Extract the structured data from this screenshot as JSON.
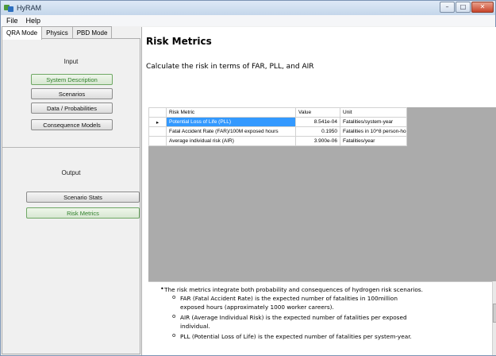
{
  "window": {
    "title": "HyRAM",
    "controls": {
      "minimize": "–",
      "maximize": "□",
      "close": "✕"
    }
  },
  "menu": [
    "File",
    "Help"
  ],
  "mode_tabs": [
    "QRA Mode",
    "Physics",
    "PBD Mode"
  ],
  "left": {
    "input_label": "Input",
    "input_buttons": [
      "System Description",
      "Scenarios",
      "Data / Probabilities",
      "Consequence Models"
    ],
    "output_label": "Output",
    "output_buttons": [
      "Scenario Stats",
      "Risk Metrics"
    ]
  },
  "main": {
    "title": "Risk Metrics",
    "subtitle": "Calculate the risk in terms of FAR, PLL, and AIR",
    "grid": {
      "headers": [
        "Risk Metric",
        "Value",
        "Unit"
      ],
      "rows": [
        {
          "metric": "Potential Loss of Life (PLL)",
          "value": "8.541e-04",
          "unit": "Fatalities/system-year"
        },
        {
          "metric": "Fatal Accident Rate (FAR)/100M exposed hours",
          "value": "0.1950",
          "unit": "Fatalities in 10^8 person-ho..."
        },
        {
          "metric": "Average individual risk (AIR)",
          "value": "3.900e-06",
          "unit": "Fatalities/year"
        }
      ],
      "current_row_marker": "▸"
    },
    "notes": {
      "main": "The risk metrics integrate both probability and consequences of hydrogen risk scenarios.",
      "far_1": "FAR (Fatal Accident Rate) is the expected number of fatalities in 100million",
      "far_2": "exposed hours (approximately 1000 worker careers).",
      "air_1": "AIR (Average Individual Risk) is the expected number of fatalities per exposed",
      "air_2": "individual.",
      "pll": "PLL (Potential Loss of Life) is the expected number of fatalities per system-year.",
      "bullet": "•",
      "sub_bullet": "o"
    }
  },
  "colors": {
    "green_text": "#2f7f2a",
    "selection": "#3399ff",
    "grid_background": "#ababab"
  }
}
